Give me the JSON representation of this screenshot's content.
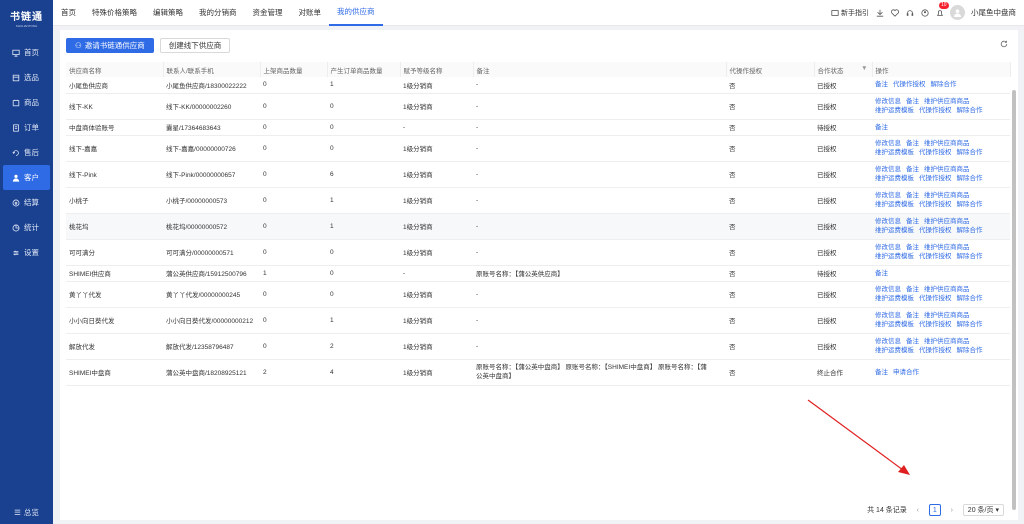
{
  "app": {
    "logo_title": "书链通",
    "logo_sub": "SHULIANTONG"
  },
  "sidebar": {
    "items": [
      {
        "label": "首页",
        "icon": "monitor-icon"
      },
      {
        "label": "选品",
        "icon": "box-icon"
      },
      {
        "label": "商品",
        "icon": "goods-icon"
      },
      {
        "label": "订单",
        "icon": "order-icon"
      },
      {
        "label": "售后",
        "icon": "aftersale-icon"
      },
      {
        "label": "客户",
        "icon": "customer-icon"
      },
      {
        "label": "结算",
        "icon": "settle-icon"
      },
      {
        "label": "统计",
        "icon": "stats-icon"
      },
      {
        "label": "设置",
        "icon": "settings-icon"
      }
    ],
    "active": "客户",
    "collapse_label": "总览"
  },
  "topnav": {
    "tabs": [
      "首页",
      "特殊价格策略",
      "编辑策略",
      "我的分销商",
      "资金管理",
      "对账单",
      "我的供应商"
    ],
    "active": "我的供应商",
    "guide": "新手指引",
    "badge": "10",
    "user": "小尾鱼中盘商"
  },
  "toolbar": {
    "invite": "邀请书链通供应商",
    "create": "创建线下供应商"
  },
  "table": {
    "headers": [
      "供应商名称",
      "联系人/联系手机",
      "上架商品数量",
      "产生订单商品数量",
      "赋予等级名称",
      "备注",
      "代操作授权",
      "合作状态",
      "操作"
    ],
    "rows": [
      {
        "name": "小尾鱼供应商",
        "contact": "小尾鱼供应商/18300022222",
        "listed": "0",
        "orders": "1",
        "level": "1级分销商",
        "remark": "-",
        "auth": "否",
        "status": "已授权",
        "ops": [
          [
            "备注",
            "代操作授权",
            "解除合作"
          ]
        ],
        "shade": false
      },
      {
        "name": "线下-KK",
        "contact": "线下-KK/00000002260",
        "listed": "0",
        "orders": "0",
        "level": "1级分销商",
        "remark": "-",
        "auth": "否",
        "status": "已授权",
        "ops": [
          [
            "修改信息",
            "备注",
            "维护供应商商品"
          ],
          [
            "维护运费模板",
            "代操作授权",
            "解除合作"
          ]
        ],
        "shade": false
      },
      {
        "name": "中盘商体验账号",
        "contact": "囊星/17364683643",
        "listed": "0",
        "orders": "0",
        "level": "-",
        "remark": "-",
        "auth": "否",
        "status": "待授权",
        "ops": [
          [
            "备注"
          ]
        ],
        "shade": false
      },
      {
        "name": "线下-嘉嘉",
        "contact": "线下-嘉嘉/00000000726",
        "listed": "0",
        "orders": "0",
        "level": "1级分销商",
        "remark": "-",
        "auth": "否",
        "status": "已授权",
        "ops": [
          [
            "修改信息",
            "备注",
            "维护供应商商品"
          ],
          [
            "维护运费模板",
            "代操作授权",
            "解除合作"
          ]
        ],
        "shade": false
      },
      {
        "name": "线下-Pink",
        "contact": "线下-Pink/00000000657",
        "listed": "0",
        "orders": "6",
        "level": "1级分销商",
        "remark": "-",
        "auth": "否",
        "status": "已授权",
        "ops": [
          [
            "修改信息",
            "备注",
            "维护供应商商品"
          ],
          [
            "维护运费模板",
            "代操作授权",
            "解除合作"
          ]
        ],
        "shade": false
      },
      {
        "name": "小桃子",
        "contact": "小桃子/00000000573",
        "listed": "0",
        "orders": "1",
        "level": "1级分销商",
        "remark": "-",
        "auth": "否",
        "status": "已授权",
        "ops": [
          [
            "修改信息",
            "备注",
            "维护供应商商品"
          ],
          [
            "维护运费模板",
            "代操作授权",
            "解除合作"
          ]
        ],
        "shade": false
      },
      {
        "name": "桃花坞",
        "contact": "桃花坞/00000000572",
        "listed": "0",
        "orders": "1",
        "level": "1级分销商",
        "remark": "-",
        "auth": "否",
        "status": "已授权",
        "ops": [
          [
            "修改信息",
            "备注",
            "维护供应商商品"
          ],
          [
            "维护运费模板",
            "代操作授权",
            "解除合作"
          ]
        ],
        "shade": true
      },
      {
        "name": "可可满分",
        "contact": "可可满分/00000000571",
        "listed": "0",
        "orders": "0",
        "level": "1级分销商",
        "remark": "-",
        "auth": "否",
        "status": "已授权",
        "ops": [
          [
            "修改信息",
            "备注",
            "维护供应商商品"
          ],
          [
            "维护运费模板",
            "代操作授权",
            "解除合作"
          ]
        ],
        "shade": false
      },
      {
        "name": "SHIMEI供应商",
        "contact": "蒲公英供应商/15912500796",
        "listed": "1",
        "orders": "0",
        "level": "-",
        "remark": "原账号名称：【蒲公英供应商】",
        "auth": "否",
        "status": "待授权",
        "ops": [
          [
            "备注"
          ]
        ],
        "shade": false
      },
      {
        "name": "黄丫丫代发",
        "contact": "黄丫丫代发/00000000245",
        "listed": "0",
        "orders": "0",
        "level": "1级分销商",
        "remark": "-",
        "auth": "否",
        "status": "已授权",
        "ops": [
          [
            "修改信息",
            "备注",
            "维护供应商商品"
          ],
          [
            "维护运费模板",
            "代操作授权",
            "解除合作"
          ]
        ],
        "shade": false
      },
      {
        "name": "小小向日葵代发",
        "contact": "小小向日葵代发/00000000212",
        "listed": "0",
        "orders": "1",
        "level": "1级分销商",
        "remark": "-",
        "auth": "否",
        "status": "已授权",
        "ops": [
          [
            "修改信息",
            "备注",
            "维护供应商商品"
          ],
          [
            "维护运费模板",
            "代操作授权",
            "解除合作"
          ]
        ],
        "shade": false
      },
      {
        "name": "解放代发",
        "contact": "解放代发/12358796487",
        "listed": "0",
        "orders": "2",
        "level": "1级分销商",
        "remark": "-",
        "auth": "否",
        "status": "已授权",
        "ops": [
          [
            "修改信息",
            "备注",
            "维护供应商商品"
          ],
          [
            "维护运费模板",
            "代操作授权",
            "解除合作"
          ]
        ],
        "shade": false
      },
      {
        "name": "SHIMEI中盘商",
        "contact": "蒲公英中盘商/18208925121",
        "listed": "2",
        "orders": "4",
        "level": "1级分销商",
        "remark": "原账号名称：【蒲公英中盘商】 原账号名称：【SHIMEI中盘商】 原账号名称：【蒲公英中盘商】",
        "auth": "否",
        "status": "终止合作",
        "ops": [
          [
            "备注",
            "申请合作"
          ]
        ],
        "shade": false
      }
    ]
  },
  "pager": {
    "total": "共 14 条记录",
    "page": "1",
    "size": "20 条/页"
  },
  "colors": {
    "sidebar": "#1a4190",
    "accent": "#2f6be5",
    "annotation": "#e02020"
  }
}
